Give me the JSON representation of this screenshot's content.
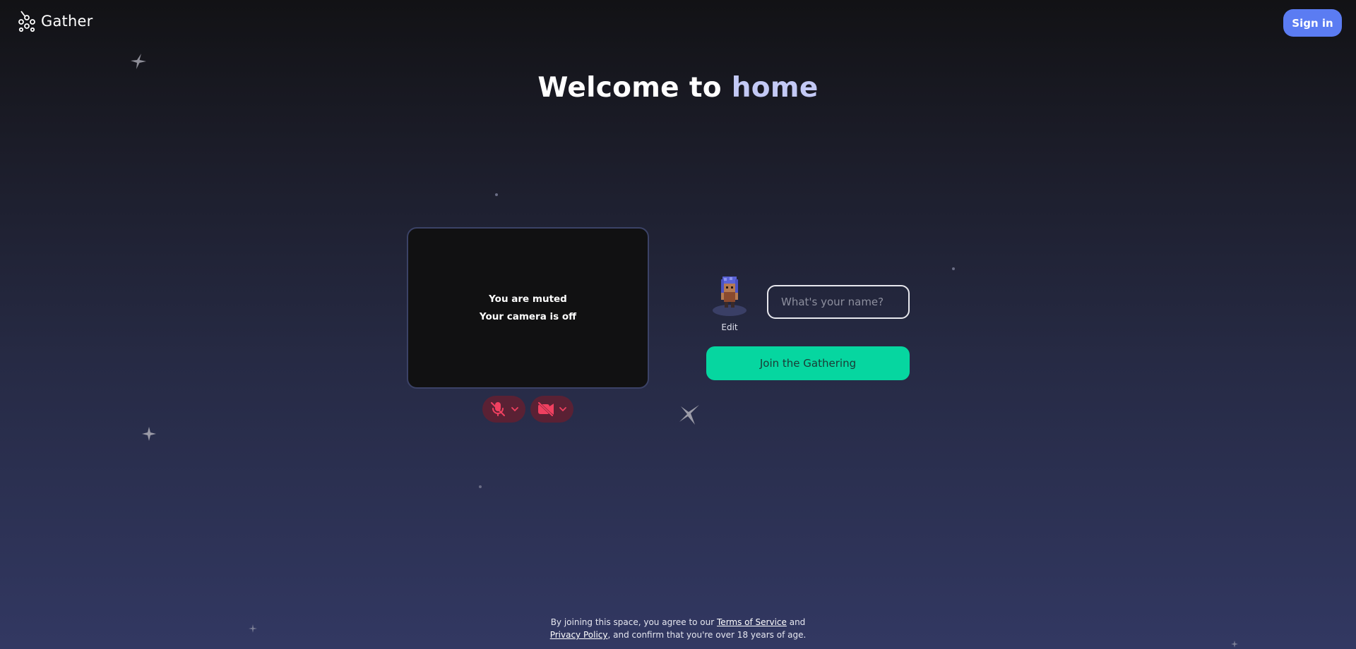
{
  "brand": {
    "name": "Gather",
    "logo_icon": "gather-logo-icon"
  },
  "header": {
    "signin_label": "Sign in"
  },
  "headline": {
    "prefix": "Welcome to ",
    "space_name": "home"
  },
  "preview": {
    "muted_text": "You are muted",
    "camera_text": "Your camera is off"
  },
  "controls": {
    "mic_icon": "mic-off-icon",
    "camera_icon": "camera-off-icon",
    "chevron_icon": "chevron-down-icon"
  },
  "avatar": {
    "edit_label": "Edit"
  },
  "form": {
    "name_placeholder": "What's your name?",
    "name_value": "",
    "join_label": "Join the Gathering"
  },
  "footer": {
    "line1_prefix": "By joining this space, you agree to our ",
    "terms_label": "Terms of Service",
    "line1_suffix": " and",
    "privacy_label": "Privacy Policy",
    "line2_suffix": ", and confirm that you're over 18 years of age."
  },
  "colors": {
    "accent_blue": "#5b7cf2",
    "join_green": "#06d6a0",
    "headline_accent": "#c3c9f5",
    "media_off_bg": "#5a2134",
    "media_off_icon": "#f04060"
  }
}
